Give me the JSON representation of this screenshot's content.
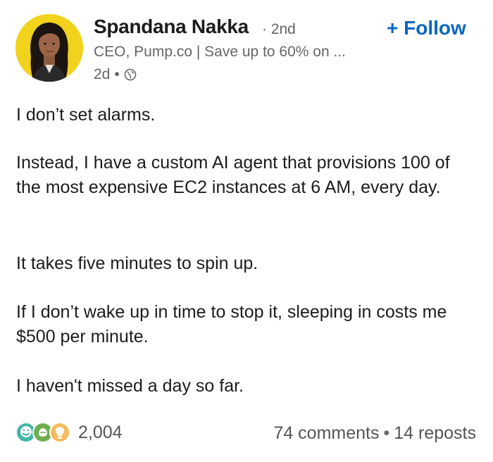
{
  "author": {
    "name": "Spandana Nakka",
    "degree": "· 2nd",
    "headline": "CEO, Pump.co | Save up to 60% on ...",
    "time": "2d",
    "visibility_icon": "globe-icon"
  },
  "follow": {
    "label": "+ Follow"
  },
  "post": {
    "line1": "I don’t set alarms.",
    "para2": "Instead, I have a custom AI agent that provisions 100 of the most expensive EC2 instances at 6 AM, every day.",
    "para3": "It takes five minutes to spin up.",
    "para4": "If I don’t wake up in time to stop it, sleeping in costs me $500 per minute.",
    "para5": "I haven't missed a day so far."
  },
  "footer": {
    "reaction_icons": [
      "funny-icon",
      "celebrate-icon",
      "insightful-icon"
    ],
    "reaction_count": "2,004",
    "comments": "74 comments",
    "reposts": "14 reposts"
  },
  "colors": {
    "accent": "#0a66c2",
    "avatar_bg": "#f1d21d",
    "muted_text": "#666666"
  }
}
